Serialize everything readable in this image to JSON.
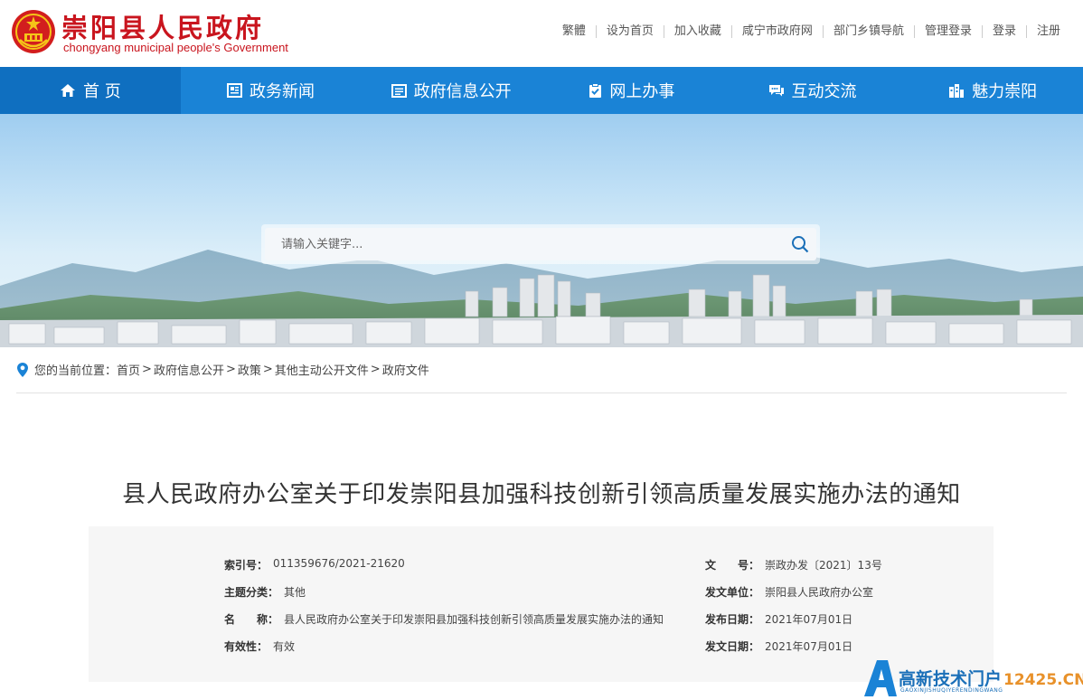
{
  "header": {
    "title": "崇阳县人民政府",
    "subtitle": "chongyang municipal people's Government",
    "links": [
      "繁體",
      "设为首页",
      "加入收藏",
      "咸宁市政府网",
      "部门乡镇导航",
      "管理登录",
      "登录",
      "注册"
    ]
  },
  "nav": [
    {
      "label": "首 页",
      "icon": "home-icon"
    },
    {
      "label": "政务新闻",
      "icon": "news-icon"
    },
    {
      "label": "政府信息公开",
      "icon": "document-icon"
    },
    {
      "label": "网上办事",
      "icon": "clipboard-check-icon"
    },
    {
      "label": "互动交流",
      "icon": "chat-icon"
    },
    {
      "label": "魅力崇阳",
      "icon": "city-icon"
    }
  ],
  "search": {
    "placeholder": "请输入关键字..."
  },
  "breadcrumb": {
    "prefix": "您的当前位置：",
    "items": [
      "首页",
      "政府信息公开",
      "政策",
      "其他主动公开文件",
      "政府文件"
    ]
  },
  "article": {
    "title": "县人民政府办公室关于印发崇阳县加强科技创新引领高质量发展实施办法的通知"
  },
  "meta": {
    "index_label": "索引号：",
    "index_value": "011359676/2021-21620",
    "theme_label": "主题分类：",
    "theme_value": "其他",
    "name_label": "名　　称：",
    "name_value": "县人民政府办公室关于印发崇阳县加强科技创新引领高质量发展实施办法的通知",
    "validity_label": "有效性：",
    "validity_value": "有效",
    "docno_label": "文　　号：",
    "docno_value": "崇政办发〔2021〕13号",
    "issuer_label": "发文单位：",
    "issuer_value": "崇阳县人民政府办公室",
    "pubdate_label": "发布日期：",
    "pubdate_value": "2021年07月01日",
    "docdate_label": "发文日期：",
    "docdate_value": "2021年07月01日"
  },
  "watermark": {
    "text": "高新技术门户",
    "domain": "12425.CN",
    "pinyin": "GAOXINJISHUQIYERENDINGWANG"
  },
  "colors": {
    "brand_red": "#c9151e",
    "nav_blue": "#1a83d6",
    "nav_active": "#0f6fc0",
    "meta_bg": "#f6f6f6"
  }
}
